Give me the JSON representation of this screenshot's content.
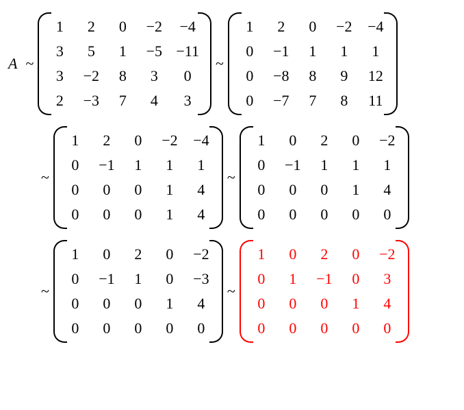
{
  "lhs_symbol": "A",
  "tilde": "~",
  "rows": 4,
  "cols": 5,
  "matrices": [
    {
      "id": "M1",
      "color": "black",
      "data": [
        [
          "1",
          "2",
          "0",
          "−2",
          "−4"
        ],
        [
          "3",
          "5",
          "1",
          "−5",
          "−11"
        ],
        [
          "3",
          "−2",
          "8",
          "3",
          "0"
        ],
        [
          "2",
          "−3",
          "7",
          "4",
          "3"
        ]
      ]
    },
    {
      "id": "M2",
      "color": "black",
      "data": [
        [
          "1",
          "2",
          "0",
          "−2",
          "−4"
        ],
        [
          "0",
          "−1",
          "1",
          "1",
          "1"
        ],
        [
          "0",
          "−8",
          "8",
          "9",
          "12"
        ],
        [
          "0",
          "−7",
          "7",
          "8",
          "11"
        ]
      ]
    },
    {
      "id": "M3",
      "color": "black",
      "data": [
        [
          "1",
          "2",
          "0",
          "−2",
          "−4"
        ],
        [
          "0",
          "−1",
          "1",
          "1",
          "1"
        ],
        [
          "0",
          "0",
          "0",
          "1",
          "4"
        ],
        [
          "0",
          "0",
          "0",
          "1",
          "4"
        ]
      ]
    },
    {
      "id": "M4",
      "color": "black",
      "data": [
        [
          "1",
          "0",
          "2",
          "0",
          "−2"
        ],
        [
          "0",
          "−1",
          "1",
          "1",
          "1"
        ],
        [
          "0",
          "0",
          "0",
          "1",
          "4"
        ],
        [
          "0",
          "0",
          "0",
          "0",
          "0"
        ]
      ]
    },
    {
      "id": "M5",
      "color": "black",
      "data": [
        [
          "1",
          "0",
          "2",
          "0",
          "−2"
        ],
        [
          "0",
          "−1",
          "1",
          "0",
          "−3"
        ],
        [
          "0",
          "0",
          "0",
          "1",
          "4"
        ],
        [
          "0",
          "0",
          "0",
          "0",
          "0"
        ]
      ]
    },
    {
      "id": "M6",
      "color": "red",
      "data": [
        [
          "1",
          "0",
          "2",
          "0",
          "−2"
        ],
        [
          "0",
          "1",
          "−1",
          "0",
          "3"
        ],
        [
          "0",
          "0",
          "0",
          "1",
          "4"
        ],
        [
          "0",
          "0",
          "0",
          "0",
          "0"
        ]
      ]
    }
  ],
  "lines": [
    {
      "lead": "A",
      "indent": false,
      "items": [
        "M1",
        "M2"
      ]
    },
    {
      "lead": "",
      "indent": true,
      "items": [
        "M3",
        "M4"
      ]
    },
    {
      "lead": "",
      "indent": true,
      "items": [
        "M5",
        "M6"
      ]
    }
  ]
}
